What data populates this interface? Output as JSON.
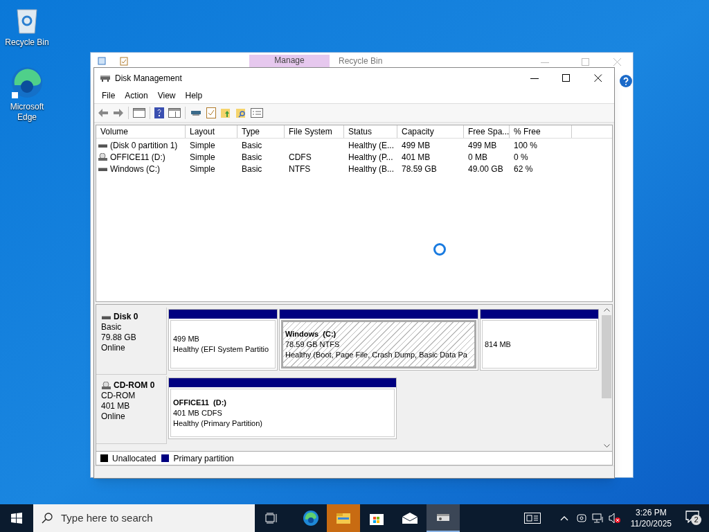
{
  "desktop_icons": [
    {
      "label": "Recycle Bin",
      "kind": "bin"
    },
    {
      "label": "Microsoft Edge",
      "kind": "edge"
    }
  ],
  "background_window": {
    "context_tab": "Manage",
    "title": "Recycle Bin"
  },
  "window": {
    "title": "Disk Management",
    "menu": [
      "File",
      "Action",
      "View",
      "Help"
    ]
  },
  "volumes": {
    "columns": [
      "Volume",
      "Layout",
      "Type",
      "File System",
      "Status",
      "Capacity",
      "Free Spa...",
      "% Free"
    ],
    "rows": [
      {
        "kind": "disk",
        "cells": [
          "(Disk 0 partition 1)",
          "Simple",
          "Basic",
          "",
          "Healthy (E...",
          "499 MB",
          "499 MB",
          "100 %"
        ]
      },
      {
        "kind": "cdrom",
        "cells": [
          "OFFICE11 (D:)",
          "Simple",
          "Basic",
          "CDFS",
          "Healthy (P...",
          "401 MB",
          "0 MB",
          "0 %"
        ]
      },
      {
        "kind": "disk",
        "cells": [
          "Windows (C:)",
          "Simple",
          "Basic",
          "NTFS",
          "Healthy (B...",
          "78.59 GB",
          "49.00 GB",
          "62 %"
        ]
      }
    ]
  },
  "disks": [
    {
      "kind": "disk",
      "name": "Disk 0",
      "type": "Basic",
      "size": "79.88 GB",
      "status": "Online",
      "partitions": [
        {
          "kind": "primary",
          "selected": false,
          "lines": [
            "499 MB",
            "Healthy (EFI System Partitio"
          ]
        },
        {
          "kind": "primary",
          "selected": true,
          "name": "Windows  (C:)",
          "lines": [
            "78.59 GB NTFS",
            "Healthy (Boot, Page File, Crash Dump, Basic Data Pa"
          ]
        },
        {
          "kind": "primary",
          "selected": false,
          "lines": [
            "814 MB"
          ]
        }
      ]
    },
    {
      "kind": "cdrom",
      "name": "CD-ROM 0",
      "type": "CD-ROM",
      "size": "401 MB",
      "status": "Online",
      "partitions": [
        {
          "kind": "primary",
          "selected": false,
          "name": "OFFICE11  (D:)",
          "lines": [
            "401 MB CDFS",
            "Healthy (Primary Partition)"
          ]
        }
      ]
    }
  ],
  "legend": [
    {
      "label": "Unallocated",
      "color": "#000000"
    },
    {
      "label": "Primary partition",
      "color": "#000080"
    }
  ],
  "taskbar": {
    "search": {
      "placeholder": "Type here to search"
    },
    "time": "3:26 PM",
    "date": "11/20/2025",
    "notifications": "2"
  }
}
